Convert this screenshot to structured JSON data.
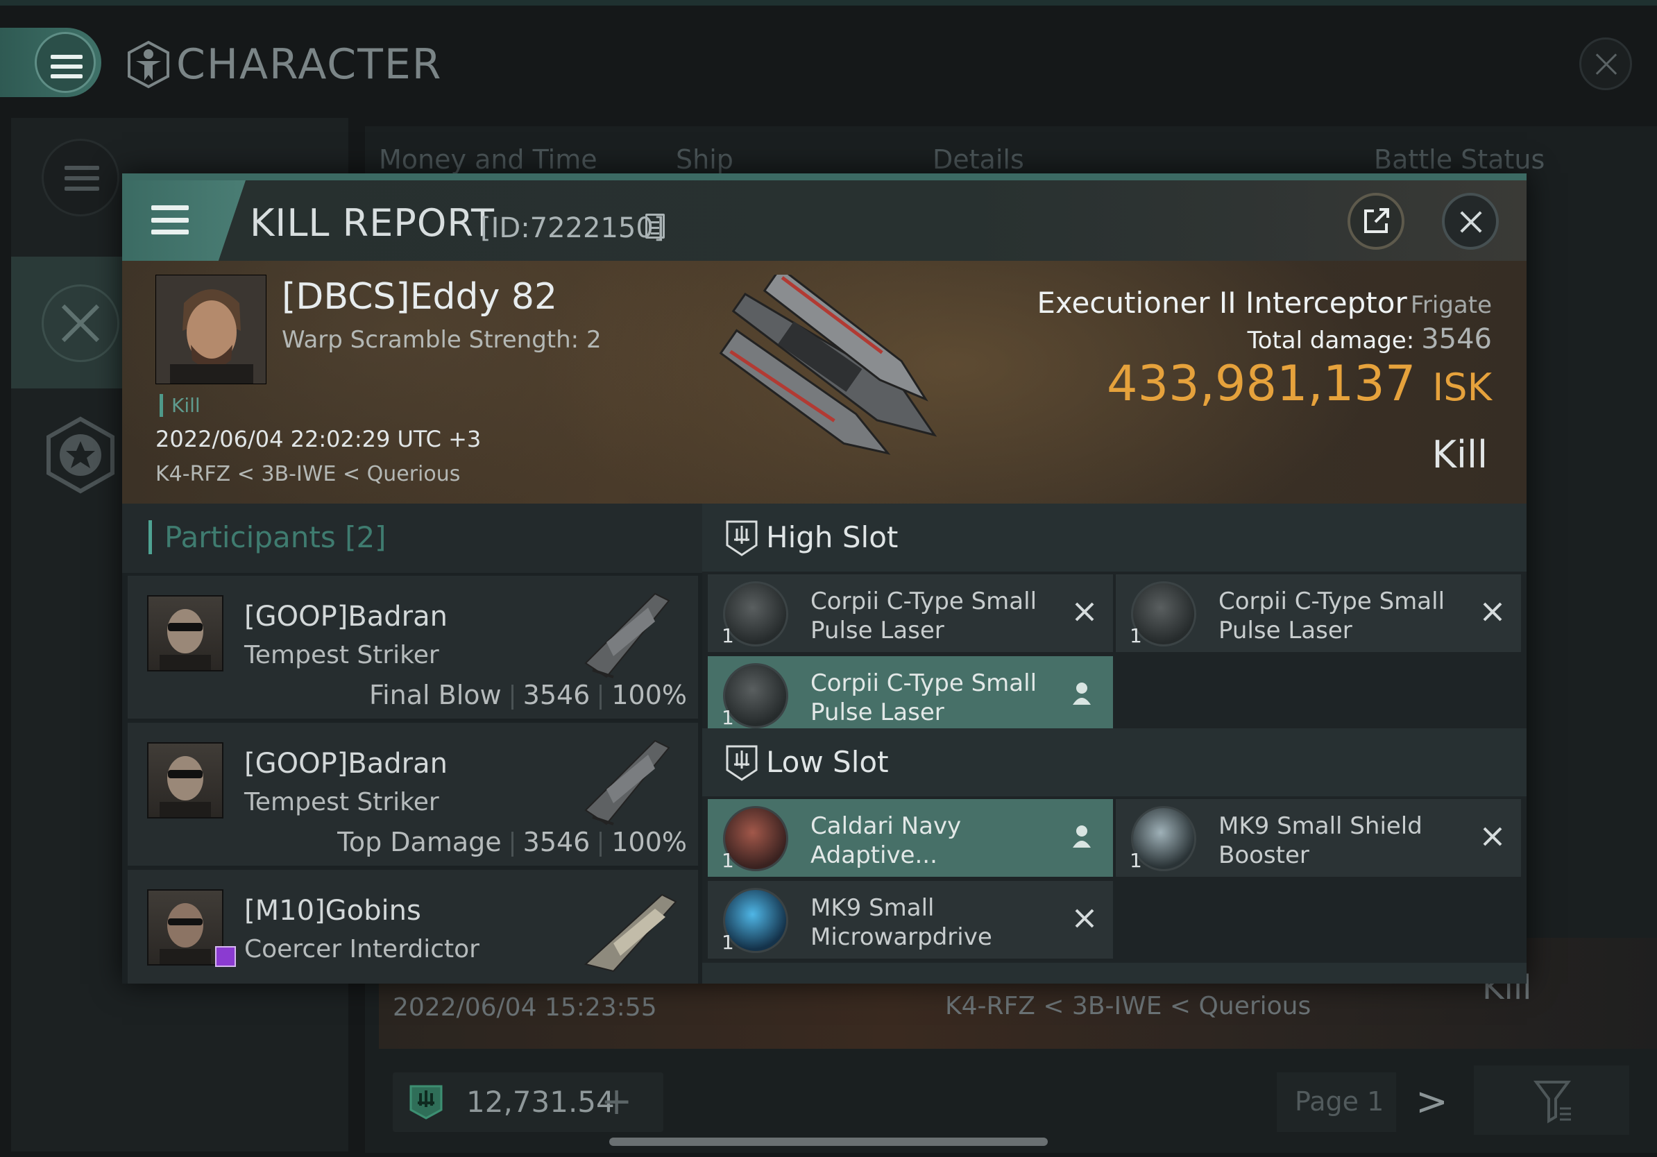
{
  "app": {
    "title": "CHARACTER",
    "columns": [
      "Money and Time",
      "Ship",
      "Details",
      "Battle Status"
    ],
    "bg_row": {
      "date": "2022/06/04 15:23:55",
      "location": "K4-RFZ < 3B-IWE < Querious",
      "result": "Kill"
    },
    "footer": {
      "balance": "12,731.54",
      "plus": "+",
      "page": "Page 1",
      "next": ">"
    }
  },
  "modal": {
    "title": "KILL REPORT",
    "id": "[ID:7222150]",
    "victim": {
      "name": "[DBCS]Eddy 82",
      "subtitle": "Warp Scramble Strength: 2",
      "tag": "Kill",
      "datetime": "2022/06/04 22:02:29 UTC +3",
      "location": "K4-RFZ < 3B-IWE < Querious",
      "ship": "Executioner II Interceptor",
      "ship_class": "Frigate",
      "total_damage_label": "Total damage:",
      "total_damage": "3546",
      "isk_value": "433,981,137",
      "isk_unit": "ISK",
      "result": "Kill"
    },
    "participants": {
      "title": "Participants",
      "count": "[2]",
      "rows": [
        {
          "name": "[GOOP]Badran",
          "ship": "Tempest Striker",
          "role": "Final Blow",
          "damage": "3546",
          "percent": "100%"
        },
        {
          "name": "[GOOP]Badran",
          "ship": "Tempest Striker",
          "role": "Top Damage",
          "damage": "3546",
          "percent": "100%"
        },
        {
          "name": "[M10]Gobins",
          "ship": "Coercer Interdictor",
          "role": "",
          "damage": "",
          "percent": ""
        }
      ]
    },
    "fitting": {
      "high_slot_label": "High Slot",
      "low_slot_label": "Low Slot",
      "high": [
        {
          "name": "Corpii C-Type Small Pulse Laser",
          "qty": "1",
          "state": "destroyed"
        },
        {
          "name": "Corpii C-Type Small Pulse Laser",
          "qty": "1",
          "state": "destroyed"
        },
        {
          "name": "Corpii C-Type Small Pulse Laser",
          "qty": "1",
          "state": "dropped"
        }
      ],
      "low": [
        {
          "name": "Caldari Navy Adaptive...",
          "qty": "1",
          "state": "dropped"
        },
        {
          "name": "MK9 Small Shield Booster",
          "qty": "1",
          "state": "destroyed"
        },
        {
          "name": "MK9 Small Microwarpdrive",
          "qty": "1",
          "state": "destroyed"
        }
      ]
    }
  },
  "colors": {
    "accent_teal": "#4fa393",
    "selected_row": "#477068",
    "isk_gold": "#e6a23c"
  }
}
